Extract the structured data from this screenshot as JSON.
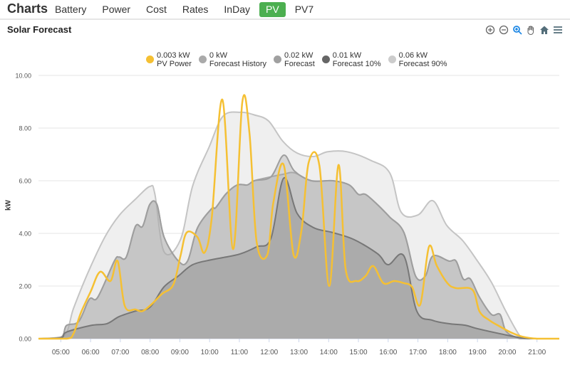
{
  "nav": {
    "brand": "Charts",
    "tabs": [
      {
        "label": "Battery",
        "active": false
      },
      {
        "label": "Power",
        "active": false
      },
      {
        "label": "Cost",
        "active": false
      },
      {
        "label": "Rates",
        "active": false
      },
      {
        "label": "InDay",
        "active": false
      },
      {
        "label": "PV",
        "active": true
      },
      {
        "label": "PV7",
        "active": false
      }
    ]
  },
  "toolbar": [
    "zoom-in-icon",
    "zoom-out-icon",
    "zoom-select-icon",
    "pan-icon",
    "home-icon",
    "menu-icon"
  ],
  "chart_data": {
    "type": "area",
    "title": "Solar Forecast",
    "xlabel": "",
    "ylabel": "kW",
    "ylim": [
      0,
      10
    ],
    "xlim_hours": [
      4.25,
      21.75
    ],
    "yticks": [
      "0.00",
      "2.00",
      "4.00",
      "6.00",
      "8.00",
      "10.00"
    ],
    "xticks": [
      "05:00",
      "06:00",
      "07:00",
      "08:00",
      "09:00",
      "10:00",
      "11:00",
      "12:00",
      "13:00",
      "14:00",
      "15:00",
      "16:00",
      "17:00",
      "18:00",
      "19:00",
      "20:00",
      "21:00"
    ],
    "grid": true,
    "legend_position": "top-center",
    "series": [
      {
        "name": "Forecast 90%",
        "legend_value": "0.06 kW",
        "color": "#cccccc",
        "fill": "#efefef",
        "stroke": "#c4c4c4",
        "points": [
          [
            4.25,
            0
          ],
          [
            5.1,
            0.1
          ],
          [
            5.43,
            1.16
          ],
          [
            5.91,
            2.5
          ],
          [
            6.48,
            3.86
          ],
          [
            6.96,
            4.68
          ],
          [
            7.51,
            5.3
          ],
          [
            7.99,
            5.78
          ],
          [
            8.16,
            5.5
          ],
          [
            8.47,
            3.3
          ],
          [
            9.02,
            3.76
          ],
          [
            9.43,
            5.8
          ],
          [
            9.98,
            7.27
          ],
          [
            10.45,
            8.45
          ],
          [
            11.03,
            8.6
          ],
          [
            11.5,
            8.5
          ],
          [
            11.98,
            8.27
          ],
          [
            12.46,
            7.5
          ],
          [
            12.94,
            7.05
          ],
          [
            13.49,
            6.92
          ],
          [
            13.97,
            7.1
          ],
          [
            14.62,
            7.1
          ],
          [
            15.4,
            6.78
          ],
          [
            16.05,
            6.3
          ],
          [
            16.44,
            4.8
          ],
          [
            17.0,
            4.7
          ],
          [
            17.5,
            5.24
          ],
          [
            17.97,
            4.3
          ],
          [
            18.5,
            3.73
          ],
          [
            19.0,
            2.95
          ],
          [
            19.47,
            2.14
          ],
          [
            19.95,
            1.05
          ],
          [
            20.43,
            0.1
          ],
          [
            20.7,
            0
          ],
          [
            21.75,
            0
          ]
        ]
      },
      {
        "name": "Forecast History",
        "legend_value": "0 kW",
        "color": "#aaaaaa",
        "fill": "rgba(170,170,170,0.35)",
        "stroke": "#a8a8a8",
        "points": [
          [
            4.25,
            0
          ],
          [
            5.0,
            0.05
          ],
          [
            5.19,
            0.5
          ],
          [
            5.6,
            0.65
          ],
          [
            5.96,
            1.5
          ],
          [
            6.24,
            1.57
          ],
          [
            6.8,
            2.95
          ],
          [
            6.96,
            3.1
          ],
          [
            7.2,
            3.1
          ],
          [
            7.51,
            4.27
          ],
          [
            7.75,
            4.27
          ],
          [
            7.99,
            5.1
          ],
          [
            8.23,
            5.1
          ],
          [
            8.47,
            3.86
          ],
          [
            8.95,
            2.95
          ],
          [
            9.26,
            2.95
          ],
          [
            9.59,
            4.2
          ],
          [
            10.07,
            4.94
          ],
          [
            10.2,
            4.97
          ],
          [
            10.55,
            5.5
          ],
          [
            10.93,
            5.84
          ],
          [
            11.27,
            5.84
          ],
          [
            11.5,
            6.0
          ],
          [
            12.06,
            6.15
          ],
          [
            12.49,
            6.25
          ],
          [
            12.85,
            6.3
          ],
          [
            13.42,
            6.0
          ],
          [
            14.14,
            6.0
          ],
          [
            14.69,
            5.84
          ],
          [
            15.0,
            5.48
          ],
          [
            15.24,
            5.48
          ],
          [
            15.65,
            5.08
          ],
          [
            16.05,
            4.62
          ],
          [
            16.53,
            4.03
          ],
          [
            16.92,
            2.38
          ],
          [
            17.25,
            2.38
          ],
          [
            17.5,
            3.14
          ],
          [
            18.04,
            2.95
          ],
          [
            18.28,
            2.95
          ],
          [
            18.52,
            2.27
          ],
          [
            18.76,
            2.27
          ],
          [
            19.07,
            1.57
          ],
          [
            19.47,
            0.92
          ],
          [
            19.76,
            0.92
          ],
          [
            19.95,
            0.3
          ],
          [
            20.3,
            0.05
          ],
          [
            20.6,
            0
          ],
          [
            21.75,
            0
          ]
        ]
      },
      {
        "name": "Forecast",
        "legend_value": "0.02 kW",
        "color": "#a0a0a0",
        "fill": "rgba(170,170,170,0.35)",
        "stroke": "#9e9e9e",
        "points": [
          [
            4.25,
            0
          ],
          [
            5.0,
            0.05
          ],
          [
            5.19,
            0.5
          ],
          [
            5.6,
            0.65
          ],
          [
            5.96,
            1.5
          ],
          [
            6.24,
            1.57
          ],
          [
            6.8,
            2.95
          ],
          [
            6.96,
            3.1
          ],
          [
            7.2,
            3.1
          ],
          [
            7.51,
            4.27
          ],
          [
            7.75,
            4.27
          ],
          [
            7.99,
            5.1
          ],
          [
            8.23,
            5.1
          ],
          [
            8.47,
            3.86
          ],
          [
            8.95,
            2.95
          ],
          [
            9.26,
            2.95
          ],
          [
            9.59,
            4.2
          ],
          [
            10.07,
            4.94
          ],
          [
            10.2,
            4.97
          ],
          [
            10.55,
            5.5
          ],
          [
            10.93,
            5.84
          ],
          [
            11.27,
            5.84
          ],
          [
            11.5,
            6.0
          ],
          [
            12.06,
            6.15
          ],
          [
            12.49,
            6.97
          ],
          [
            12.85,
            6.37
          ],
          [
            13.42,
            6.0
          ],
          [
            14.14,
            6.0
          ],
          [
            14.69,
            5.84
          ],
          [
            15.0,
            5.48
          ],
          [
            15.24,
            5.48
          ],
          [
            15.65,
            5.08
          ],
          [
            16.05,
            4.62
          ],
          [
            16.53,
            4.03
          ],
          [
            16.92,
            2.38
          ],
          [
            17.25,
            2.38
          ],
          [
            17.5,
            3.14
          ],
          [
            18.04,
            2.95
          ],
          [
            18.28,
            2.95
          ],
          [
            18.52,
            2.27
          ],
          [
            18.76,
            2.27
          ],
          [
            19.07,
            1.57
          ],
          [
            19.47,
            0.92
          ],
          [
            19.76,
            0.92
          ],
          [
            19.95,
            0.3
          ],
          [
            20.3,
            0.05
          ],
          [
            20.6,
            0
          ],
          [
            21.75,
            0
          ]
        ]
      },
      {
        "name": "Forecast 10%",
        "legend_value": "0.01 kW",
        "color": "#666666",
        "fill": "rgba(150,150,150,0.55)",
        "stroke": "#777777",
        "points": [
          [
            4.25,
            0
          ],
          [
            5.0,
            0.03
          ],
          [
            5.19,
            0.25
          ],
          [
            6.0,
            0.5
          ],
          [
            6.55,
            0.57
          ],
          [
            6.96,
            0.84
          ],
          [
            7.51,
            1.05
          ],
          [
            7.99,
            1.19
          ],
          [
            8.47,
            1.97
          ],
          [
            8.95,
            2.38
          ],
          [
            9.43,
            2.81
          ],
          [
            10.07,
            3.0
          ],
          [
            10.45,
            3.08
          ],
          [
            11.03,
            3.22
          ],
          [
            11.58,
            3.49
          ],
          [
            12.06,
            3.81
          ],
          [
            12.49,
            6.1
          ],
          [
            12.94,
            4.76
          ],
          [
            13.49,
            4.22
          ],
          [
            14.14,
            4.03
          ],
          [
            14.86,
            3.76
          ],
          [
            15.65,
            3.22
          ],
          [
            16.0,
            2.81
          ],
          [
            16.53,
            3.14
          ],
          [
            16.96,
            1.05
          ],
          [
            17.48,
            0.7
          ],
          [
            18.04,
            0.57
          ],
          [
            18.59,
            0.51
          ],
          [
            19.0,
            0.38
          ],
          [
            19.88,
            0.16
          ],
          [
            20.5,
            0.03
          ],
          [
            21.0,
            0
          ],
          [
            21.75,
            0
          ]
        ]
      },
      {
        "name": "PV Power",
        "legend_value": "0.003 kW",
        "color": "#f5c033",
        "stroke": "#f5c033",
        "line": true,
        "points": [
          [
            4.25,
            0
          ],
          [
            5.2,
            0
          ],
          [
            5.43,
            0.2
          ],
          [
            5.67,
            0.97
          ],
          [
            6.0,
            1.78
          ],
          [
            6.32,
            2.54
          ],
          [
            6.67,
            2.19
          ],
          [
            6.91,
            2.95
          ],
          [
            7.15,
            1.24
          ],
          [
            7.51,
            1.11
          ],
          [
            7.75,
            1.05
          ],
          [
            8.06,
            1.32
          ],
          [
            8.4,
            1.7
          ],
          [
            8.78,
            2.05
          ],
          [
            9.02,
            3.14
          ],
          [
            9.23,
            4.03
          ],
          [
            9.59,
            3.86
          ],
          [
            9.83,
            3.27
          ],
          [
            10.07,
            4.57
          ],
          [
            10.43,
            9.08
          ],
          [
            10.79,
            3.4
          ],
          [
            11.1,
            9.0
          ],
          [
            11.34,
            7.8
          ],
          [
            11.58,
            3.68
          ],
          [
            11.94,
            3.19
          ],
          [
            12.14,
            5.16
          ],
          [
            12.49,
            6.6
          ],
          [
            12.82,
            3.19
          ],
          [
            13.09,
            4.14
          ],
          [
            13.33,
            6.7
          ],
          [
            13.69,
            6.57
          ],
          [
            14.02,
            2.0
          ],
          [
            14.33,
            6.6
          ],
          [
            14.57,
            2.65
          ],
          [
            14.93,
            2.19
          ],
          [
            15.24,
            2.38
          ],
          [
            15.5,
            2.76
          ],
          [
            15.84,
            2.11
          ],
          [
            16.2,
            2.19
          ],
          [
            16.53,
            2.11
          ],
          [
            16.8,
            1.97
          ],
          [
            17.08,
            1.3
          ],
          [
            17.37,
            3.49
          ],
          [
            17.63,
            2.78
          ],
          [
            17.99,
            2.11
          ],
          [
            18.28,
            1.92
          ],
          [
            18.83,
            1.86
          ],
          [
            19.07,
            1.03
          ],
          [
            19.4,
            0.7
          ],
          [
            19.71,
            0.49
          ],
          [
            20.12,
            0.24
          ],
          [
            20.5,
            0.08
          ],
          [
            21.0,
            0
          ],
          [
            21.75,
            0
          ]
        ]
      }
    ]
  }
}
